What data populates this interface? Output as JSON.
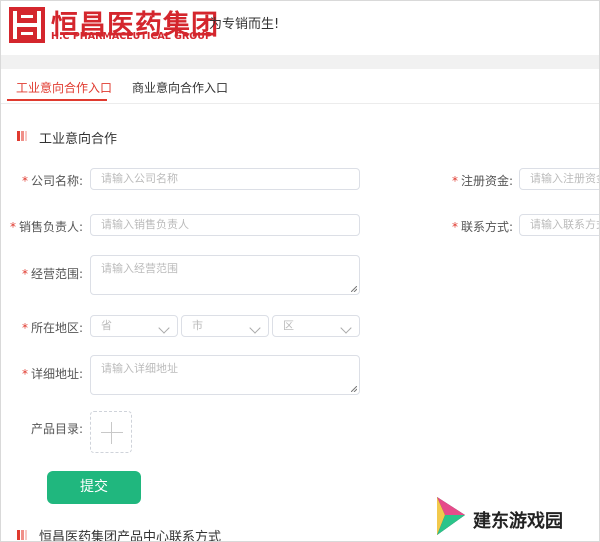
{
  "header": {
    "logo_cn": "恒昌医药集团",
    "logo_en": "H.C PHARMACEUTICAL GROUP",
    "slogan": "为专销而生!"
  },
  "tabs": [
    {
      "label": "工业意向合作入口",
      "active": true
    },
    {
      "label": "商业意向合作入口",
      "active": false
    }
  ],
  "section1": {
    "title": "工业意向合作"
  },
  "form": {
    "company": {
      "label": "公司名称:",
      "placeholder": "请输入公司名称"
    },
    "capital": {
      "label": "注册资金:",
      "placeholder": "请输入注册资金"
    },
    "sales": {
      "label": "销售负责人:",
      "placeholder": "请输入销售负责人"
    },
    "contact": {
      "label": "联系方式:",
      "placeholder": "请输入联系方式"
    },
    "scope": {
      "label": "经营范围:",
      "placeholder": "请输入经营范围"
    },
    "region": {
      "label": "所在地区:",
      "province": "省",
      "city": "市",
      "district": "区"
    },
    "address": {
      "label": "详细地址:",
      "placeholder": "请输入详细地址"
    },
    "catalog": {
      "label": "产品目录:"
    },
    "submit": "提交"
  },
  "section2": {
    "title": "恒昌医药集团产品中心联系方式"
  },
  "watermark": {
    "text": "建东游戏园"
  },
  "colors": {
    "brand_red": "#d4262d",
    "accent_red": "#e03a2f",
    "submit_green": "#20b77e"
  }
}
